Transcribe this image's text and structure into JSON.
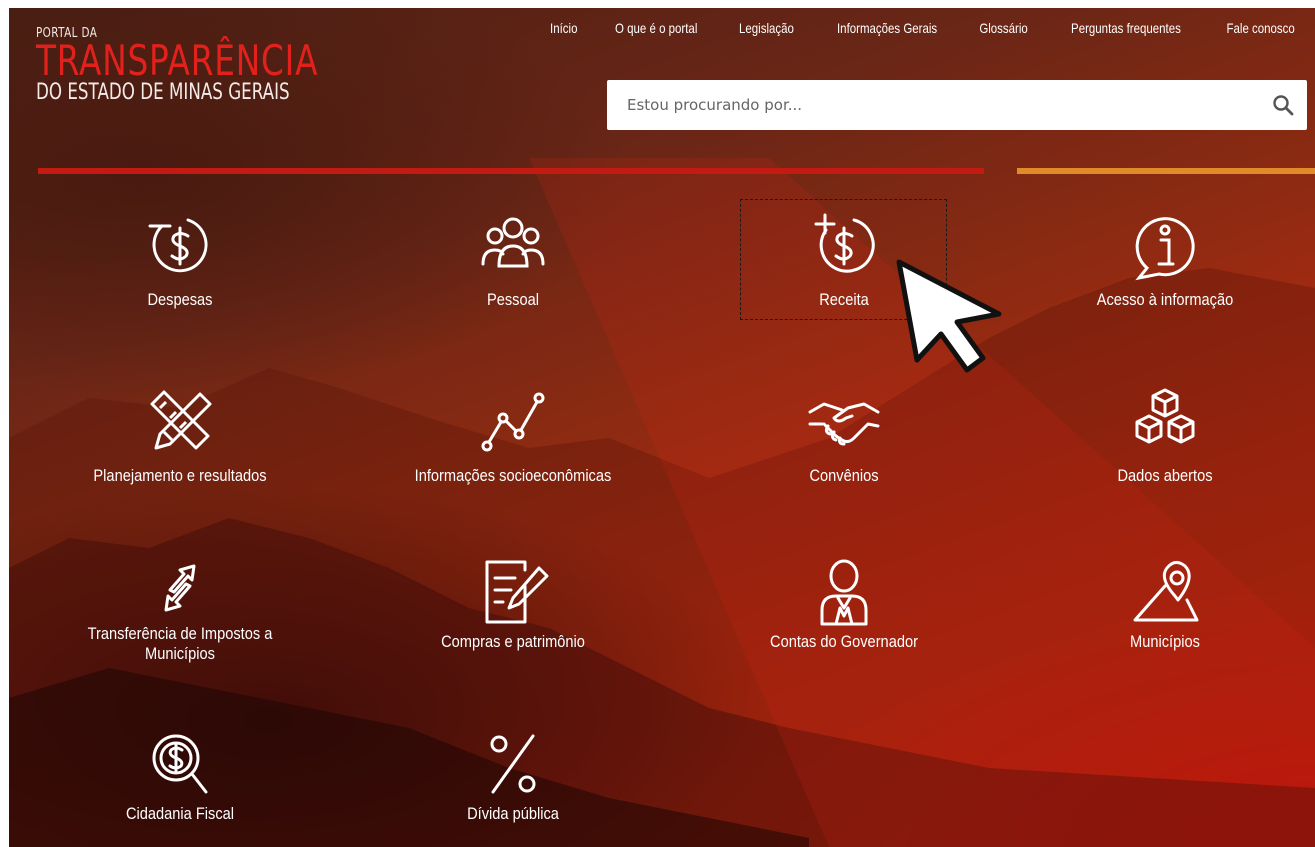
{
  "logo": {
    "small": "PORTAL DA",
    "big": "TRANSPARÊNCIA",
    "sub": "DO ESTADO DE MINAS GERAIS"
  },
  "nav": [
    {
      "label": "Início"
    },
    {
      "label": "O que é o portal"
    },
    {
      "label": "Legislação"
    },
    {
      "label": "Informações Gerais"
    },
    {
      "label": "Glossário"
    },
    {
      "label": "Perguntas frequentes"
    },
    {
      "label": "Fale conosco"
    }
  ],
  "search": {
    "placeholder": "Estou procurando por..."
  },
  "colors": {
    "brand_red": "#e2211c",
    "bar_red": "#c31a12",
    "bar_orange": "#e08a2a"
  },
  "tiles": [
    {
      "label": "Despesas",
      "icon": "money-minus-icon"
    },
    {
      "label": "Pessoal",
      "icon": "people-icon"
    },
    {
      "label": "Receita",
      "icon": "money-plus-icon"
    },
    {
      "label": "Acesso à informação",
      "icon": "info-speech-icon"
    },
    {
      "label": "Planejamento e resultados",
      "icon": "pencil-ruler-icon"
    },
    {
      "label": "Informações socioeconômicas",
      "icon": "line-chart-icon"
    },
    {
      "label": "Convênios",
      "icon": "handshake-icon"
    },
    {
      "label": "Dados abertos",
      "icon": "cubes-icon"
    },
    {
      "label": "Transferência de Impostos a Municípios",
      "icon": "transfer-arrows-icon"
    },
    {
      "label": "Compras e patrimônio",
      "icon": "document-edit-icon"
    },
    {
      "label": "Contas do Governador",
      "icon": "governor-icon"
    },
    {
      "label": "Municípios",
      "icon": "map-pin-icon"
    },
    {
      "label": "Cidadania Fiscal",
      "icon": "money-magnifier-icon"
    },
    {
      "label": "Dívida pública",
      "icon": "percent-icon"
    }
  ]
}
